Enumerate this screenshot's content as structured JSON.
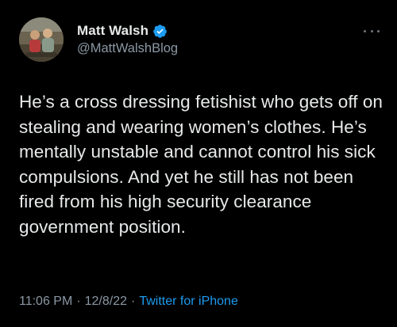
{
  "tweet": {
    "author": {
      "display_name": "Matt Walsh",
      "handle": "@MattWalshBlog",
      "verified": true,
      "verified_color": "#1d9bf0"
    },
    "more_icon": "more-dots-icon",
    "text": "He’s a cross dressing fetishist who gets off on stealing and wearing women’s clothes. He’s mentally unstable and cannot control his sick compulsions. And yet he still has not been fired from his high security clearance government position.",
    "time": "11:06 PM",
    "separator": "·",
    "date": "12/8/22",
    "source": "Twitter for iPhone",
    "colors": {
      "background": "#000000",
      "text": "#e7e9ea",
      "secondary": "#8b98a5",
      "accent": "#1d9bf0"
    }
  }
}
